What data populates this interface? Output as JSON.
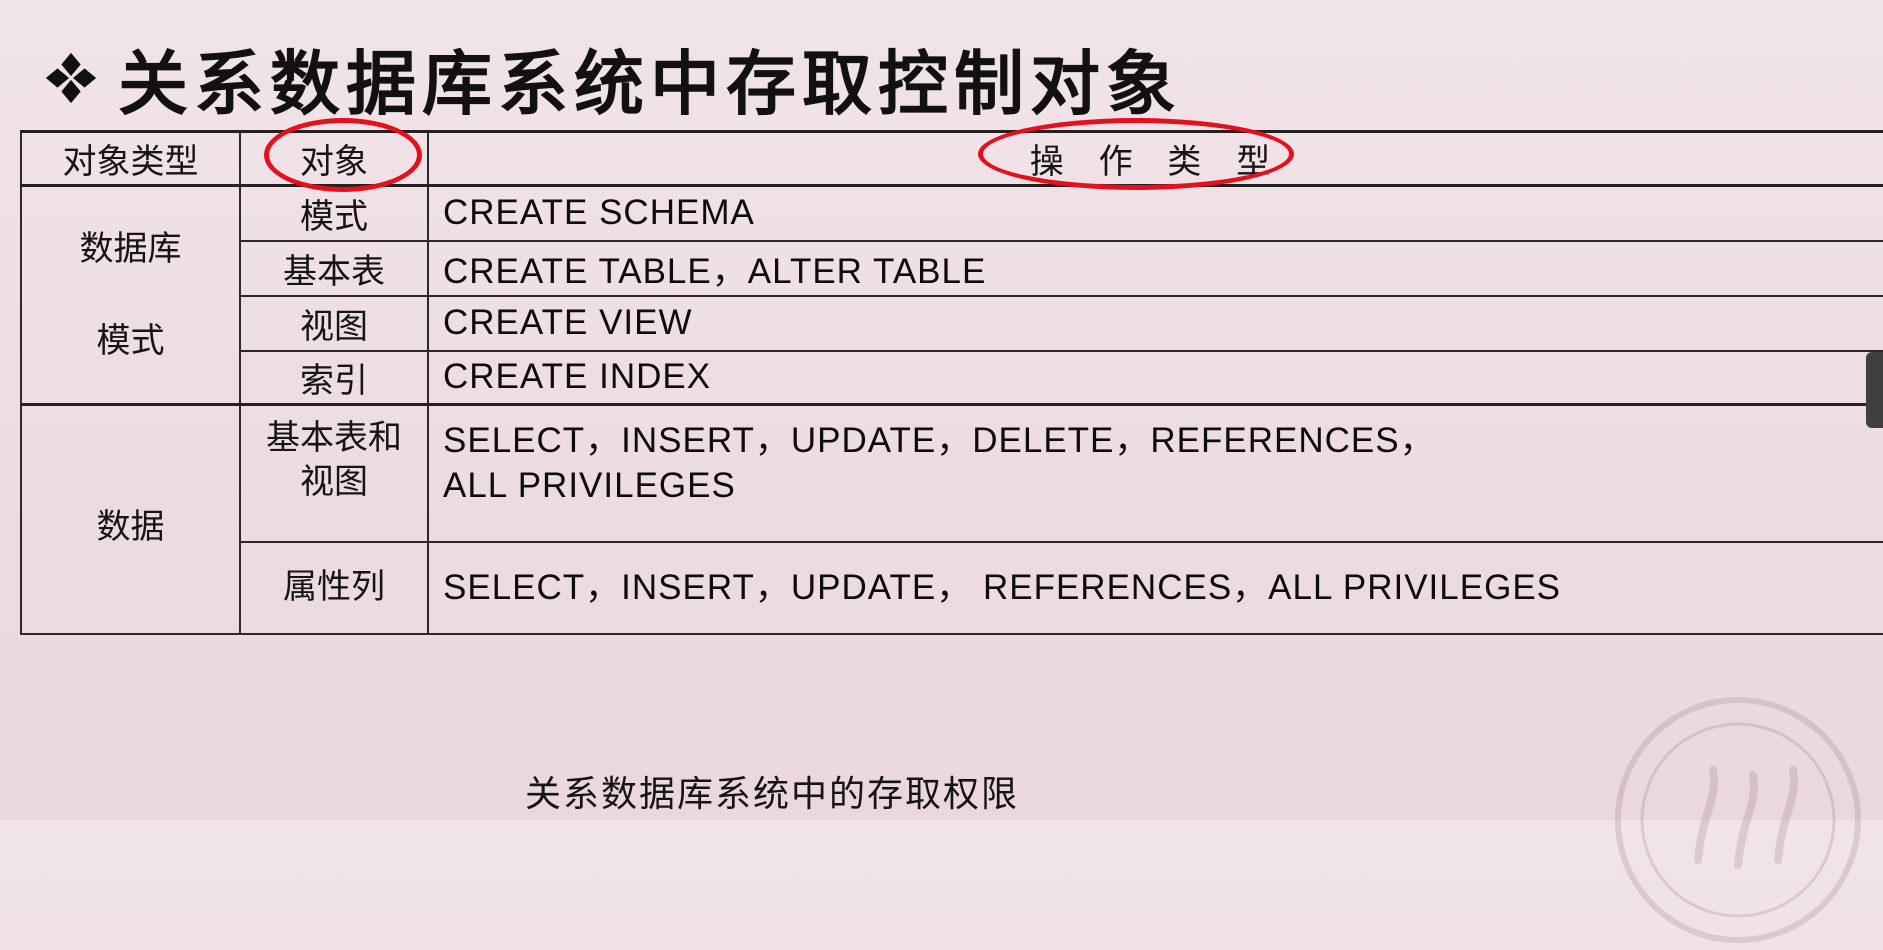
{
  "title": "关系数据库系统中存取控制对象",
  "table": {
    "headers": {
      "object_type": "对象类型",
      "object": "对象",
      "operation_type": "操 作 类 型"
    },
    "groups": [
      {
        "type_line1": "数据库",
        "type_line2": "模式",
        "rows": [
          {
            "object": "模式",
            "ops": "CREATE SCHEMA"
          },
          {
            "object": "基本表",
            "ops": "CREATE TABLE，ALTER TABLE"
          },
          {
            "object": "视图",
            "ops": "CREATE VIEW"
          },
          {
            "object": "索引",
            "ops": "CREATE INDEX"
          }
        ]
      },
      {
        "type_line1": "数据",
        "rows": [
          {
            "object_line1": "基本表和",
            "object_line2": "视图",
            "ops_line1": "SELECT，INSERT，UPDATE，DELETE，REFERENCES，",
            "ops_line2": "ALL PRIVILEGES"
          },
          {
            "object": "属性列",
            "ops": "SELECT，INSERT，UPDATE， REFERENCES，ALL PRIVILEGES"
          }
        ]
      }
    ]
  },
  "caption": "关系数据库系统中的存取权限",
  "colors": {
    "background": "#eddde2",
    "highlight_oval": "#e5101d",
    "text": "#111111"
  },
  "icons": {
    "title_bullet": "four-diamond-bullet-icon",
    "watermark": "university-seal-icon"
  }
}
